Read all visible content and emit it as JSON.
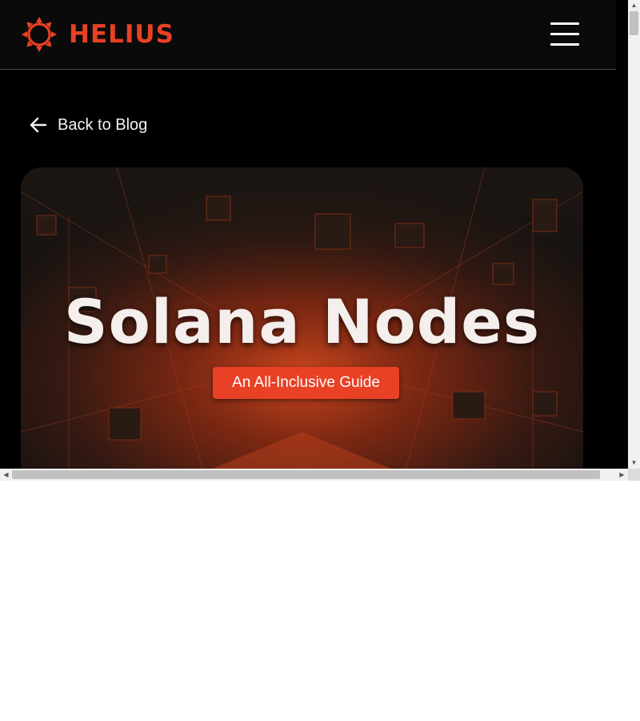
{
  "brand": {
    "name": "HELIUS",
    "accent_color": "#e84125"
  },
  "header": {
    "menu_icon": "hamburger-menu-icon"
  },
  "navigation": {
    "back_label": "Back to Blog",
    "back_icon": "arrow-left-icon"
  },
  "hero": {
    "title": "Solana Nodes",
    "badge": "An All-Inclusive Guide"
  },
  "scrollbars": {
    "vertical": {
      "up_icon": "scroll-up-arrow-icon",
      "down_icon": "scroll-down-arrow-icon"
    },
    "horizontal": {
      "left_icon": "scroll-left-arrow-icon",
      "right_icon": "scroll-right-arrow-icon"
    }
  }
}
